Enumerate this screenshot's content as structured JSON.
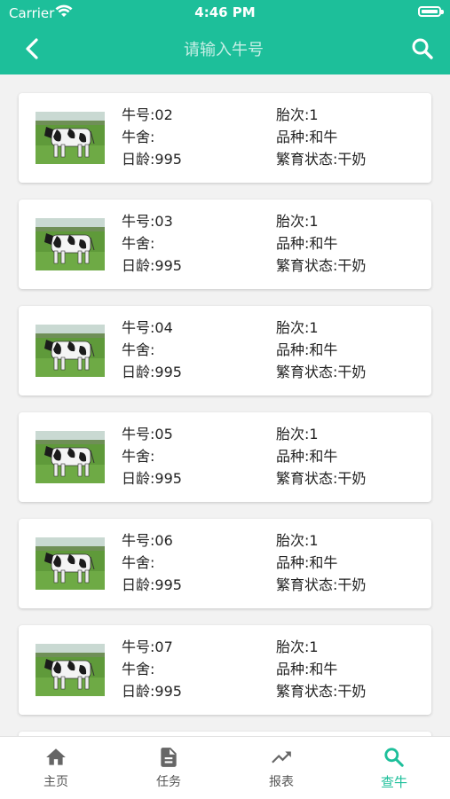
{
  "status_bar": {
    "carrier": "Carrier",
    "time": "4:46 PM"
  },
  "nav": {
    "search_placeholder": "请输入牛号"
  },
  "labels": {
    "cow_no": "牛号:",
    "parity": "胎次:",
    "barn": "牛舍:",
    "breed": "品种:",
    "age_days": "日龄:",
    "breeding_status": "繁育状态:"
  },
  "cows": [
    {
      "cow_no": "02",
      "parity": "1",
      "barn": "",
      "breed": "和牛",
      "age_days": "995",
      "breeding_status": "干奶"
    },
    {
      "cow_no": "03",
      "parity": "1",
      "barn": "",
      "breed": "和牛",
      "age_days": "995",
      "breeding_status": "干奶"
    },
    {
      "cow_no": "04",
      "parity": "1",
      "barn": "",
      "breed": "和牛",
      "age_days": "995",
      "breeding_status": "干奶"
    },
    {
      "cow_no": "05",
      "parity": "1",
      "barn": "",
      "breed": "和牛",
      "age_days": "995",
      "breeding_status": "干奶"
    },
    {
      "cow_no": "06",
      "parity": "1",
      "barn": "",
      "breed": "和牛",
      "age_days": "995",
      "breeding_status": "干奶"
    },
    {
      "cow_no": "07",
      "parity": "1",
      "barn": "",
      "breed": "和牛",
      "age_days": "995",
      "breeding_status": "干奶"
    }
  ],
  "tabs": [
    {
      "label": "主页",
      "icon": "home-icon",
      "active": false
    },
    {
      "label": "任务",
      "icon": "document-icon",
      "active": false
    },
    {
      "label": "报表",
      "icon": "trending-up-icon",
      "active": false
    },
    {
      "label": "查牛",
      "icon": "search-icon",
      "active": true
    }
  ],
  "colors": {
    "accent": "#1dbf9a",
    "background": "#f2f2f2"
  }
}
